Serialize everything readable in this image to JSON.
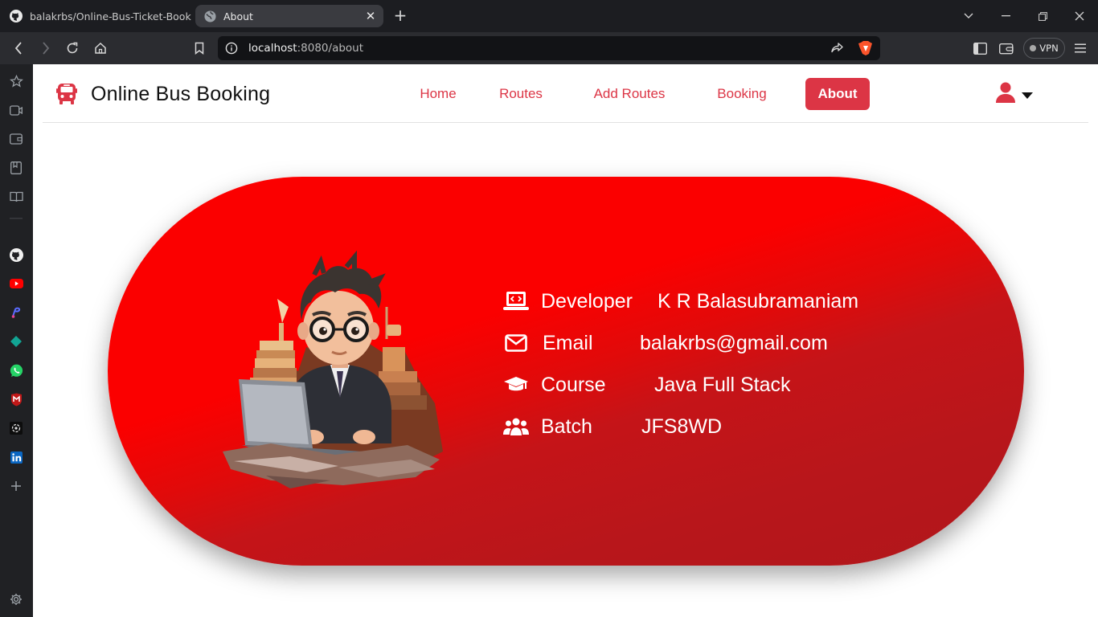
{
  "browser": {
    "tabs": [
      {
        "title": "balakrbs/Online-Bus-Ticket-Booking",
        "icon": "github-icon",
        "active": false
      },
      {
        "title": "About",
        "icon": "globe-icon",
        "active": true
      }
    ],
    "address": {
      "host": "localhost",
      "path": ":8080/about"
    },
    "vpn_label": "VPN"
  },
  "sidebar": {
    "items": [
      "star-icon",
      "video-icon",
      "wallet-icon",
      "bookmark-icon",
      "reader-icon",
      "github-icon",
      "youtube-icon",
      "app-icon",
      "diamond-icon",
      "whatsapp-icon",
      "mcafee-icon",
      "chatgpt-icon",
      "linkedin-icon",
      "add-icon",
      "settings-icon"
    ]
  },
  "site": {
    "brand": "Online Bus Booking",
    "nav": [
      {
        "label": "Home",
        "active": false
      },
      {
        "label": "Routes",
        "active": false
      },
      {
        "label": "Add Routes",
        "active": false
      },
      {
        "label": "Booking",
        "active": false
      },
      {
        "label": "About",
        "active": true
      }
    ],
    "accent_color": "#dc3545"
  },
  "about": {
    "card_color": "#fb0000",
    "rows": [
      {
        "icon": "laptop-code-icon",
        "label": "Developer",
        "value": "K R Balasubramaniam"
      },
      {
        "icon": "envelope-icon",
        "label": "Email",
        "value": "balakrbs@gmail.com"
      },
      {
        "icon": "graduation-cap-icon",
        "label": "Course",
        "value": "Java Full Stack"
      },
      {
        "icon": "users-icon",
        "label": "Batch",
        "value": "JFS8WD"
      }
    ]
  }
}
